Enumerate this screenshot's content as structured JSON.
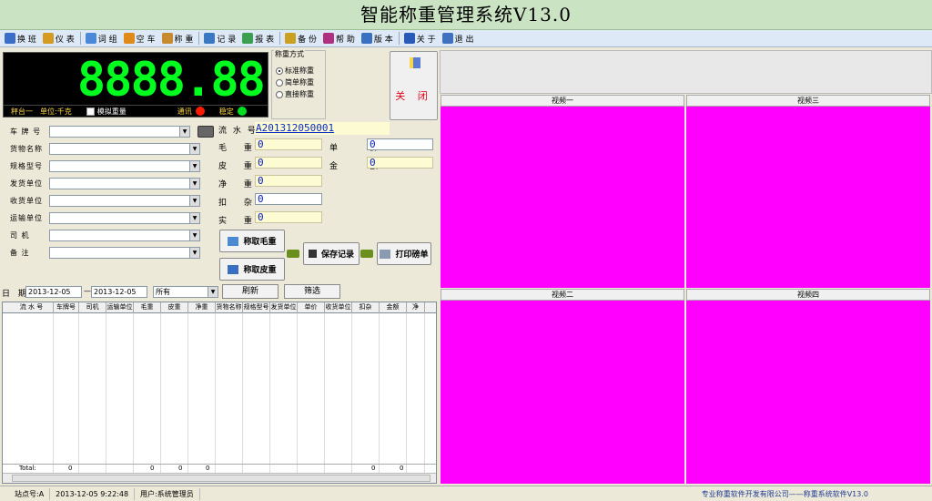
{
  "window": {
    "title": "智能称重管理系统V13.0"
  },
  "toolbar": {
    "items": [
      {
        "label": "换 班",
        "icon": "people-icon",
        "color": "#3a6ec8"
      },
      {
        "label": "仪 表",
        "icon": "meter-icon",
        "color": "#d49a22"
      },
      {
        "label": "词 组",
        "icon": "pen-icon",
        "color": "#4b89d8"
      },
      {
        "label": "空 车",
        "icon": "truck-icon",
        "color": "#e08a1a"
      },
      {
        "label": "称 重",
        "icon": "scale-icon",
        "color": "#c78a2e"
      },
      {
        "label": "记 录",
        "icon": "table-icon",
        "color": "#3b78c2"
      },
      {
        "label": "报 表",
        "icon": "grid-icon",
        "color": "#3aa050"
      },
      {
        "label": "备 份",
        "icon": "backup-icon",
        "color": "#c9a020"
      },
      {
        "label": "帮 助",
        "icon": "help-icon",
        "color": "#b03080"
      },
      {
        "label": "版 本",
        "icon": "version-icon",
        "color": "#3a70c0"
      },
      {
        "label": "关 于",
        "icon": "about-icon",
        "color": "#2a5ab8"
      },
      {
        "label": "退 出",
        "icon": "exit-icon",
        "color": "#4070c0"
      }
    ]
  },
  "display": {
    "value": "8888.88",
    "platform": "秤台一",
    "unit": "单位:千克",
    "simulate_label": "模拟重量",
    "comm_label": "通讯",
    "stable_label": "稳定",
    "comm_color": "#ff1a00",
    "stable_color": "#00e020"
  },
  "weigh_mode": {
    "title": "称重方式",
    "options": [
      "标准称重",
      "简单称重",
      "直接称重"
    ],
    "selected": 0
  },
  "close_button": {
    "label": "关 闭"
  },
  "form": {
    "fields": [
      {
        "label": "车 牌 号",
        "value": "",
        "combo": true
      },
      {
        "label": "货物名称",
        "value": "",
        "combo": true
      },
      {
        "label": "规格型号",
        "value": "",
        "combo": true
      },
      {
        "label": "发货单位",
        "value": "",
        "combo": true
      },
      {
        "label": "收货单位",
        "value": "",
        "combo": true
      },
      {
        "label": "运输单位",
        "value": "",
        "combo": true
      },
      {
        "label": "司    机",
        "value": "",
        "combo": true
      },
      {
        "label": "备    注",
        "value": "",
        "combo": true
      }
    ]
  },
  "weights": {
    "serial_label": "流 水 号",
    "serial_value": "A201312050001",
    "gross_label": "毛 重",
    "gross": "0",
    "tare_label": "皮 重",
    "tare": "0",
    "net_label": "净 重",
    "net": "0",
    "deduct_label": "扣 杂",
    "deduct": "0",
    "actual_label": "实 重",
    "actual": "0",
    "price_label": "单 价",
    "price": "0",
    "amount_label": "金 额",
    "amount": "0"
  },
  "actions": {
    "gross_button": "称取毛重",
    "tare_button": "称取皮重",
    "save_button": "保存记录",
    "print_button": "打印磅单"
  },
  "filter": {
    "date_label": "日 期",
    "date_from": "2013-12-05",
    "date_to": "2013-12-05",
    "dash": "—",
    "scope": "所有",
    "refresh": "刷新",
    "filter": "筛选"
  },
  "grid": {
    "columns": [
      "流 水 号",
      "车牌号",
      "司机",
      "运输单位",
      "毛重",
      "皮重",
      "净重",
      "货物名称",
      "规格型号",
      "发货单位",
      "单价",
      "收货单位",
      "扣杂",
      "金额",
      "净"
    ],
    "total_label": "Total:",
    "totals": [
      "0",
      "0",
      "0",
      "0",
      "0",
      "0"
    ]
  },
  "videos": {
    "v1": "视频一",
    "v2": "视频二",
    "v3": "视频三",
    "v4": "视频四",
    "color": "#ff00ff"
  },
  "status": {
    "station": "站点号:A",
    "datetime": "2013-12-05  9:22:48",
    "user": "用户:系统管理员",
    "company": "专业称重软件开发有限公司——称重系统软件V13.0"
  }
}
